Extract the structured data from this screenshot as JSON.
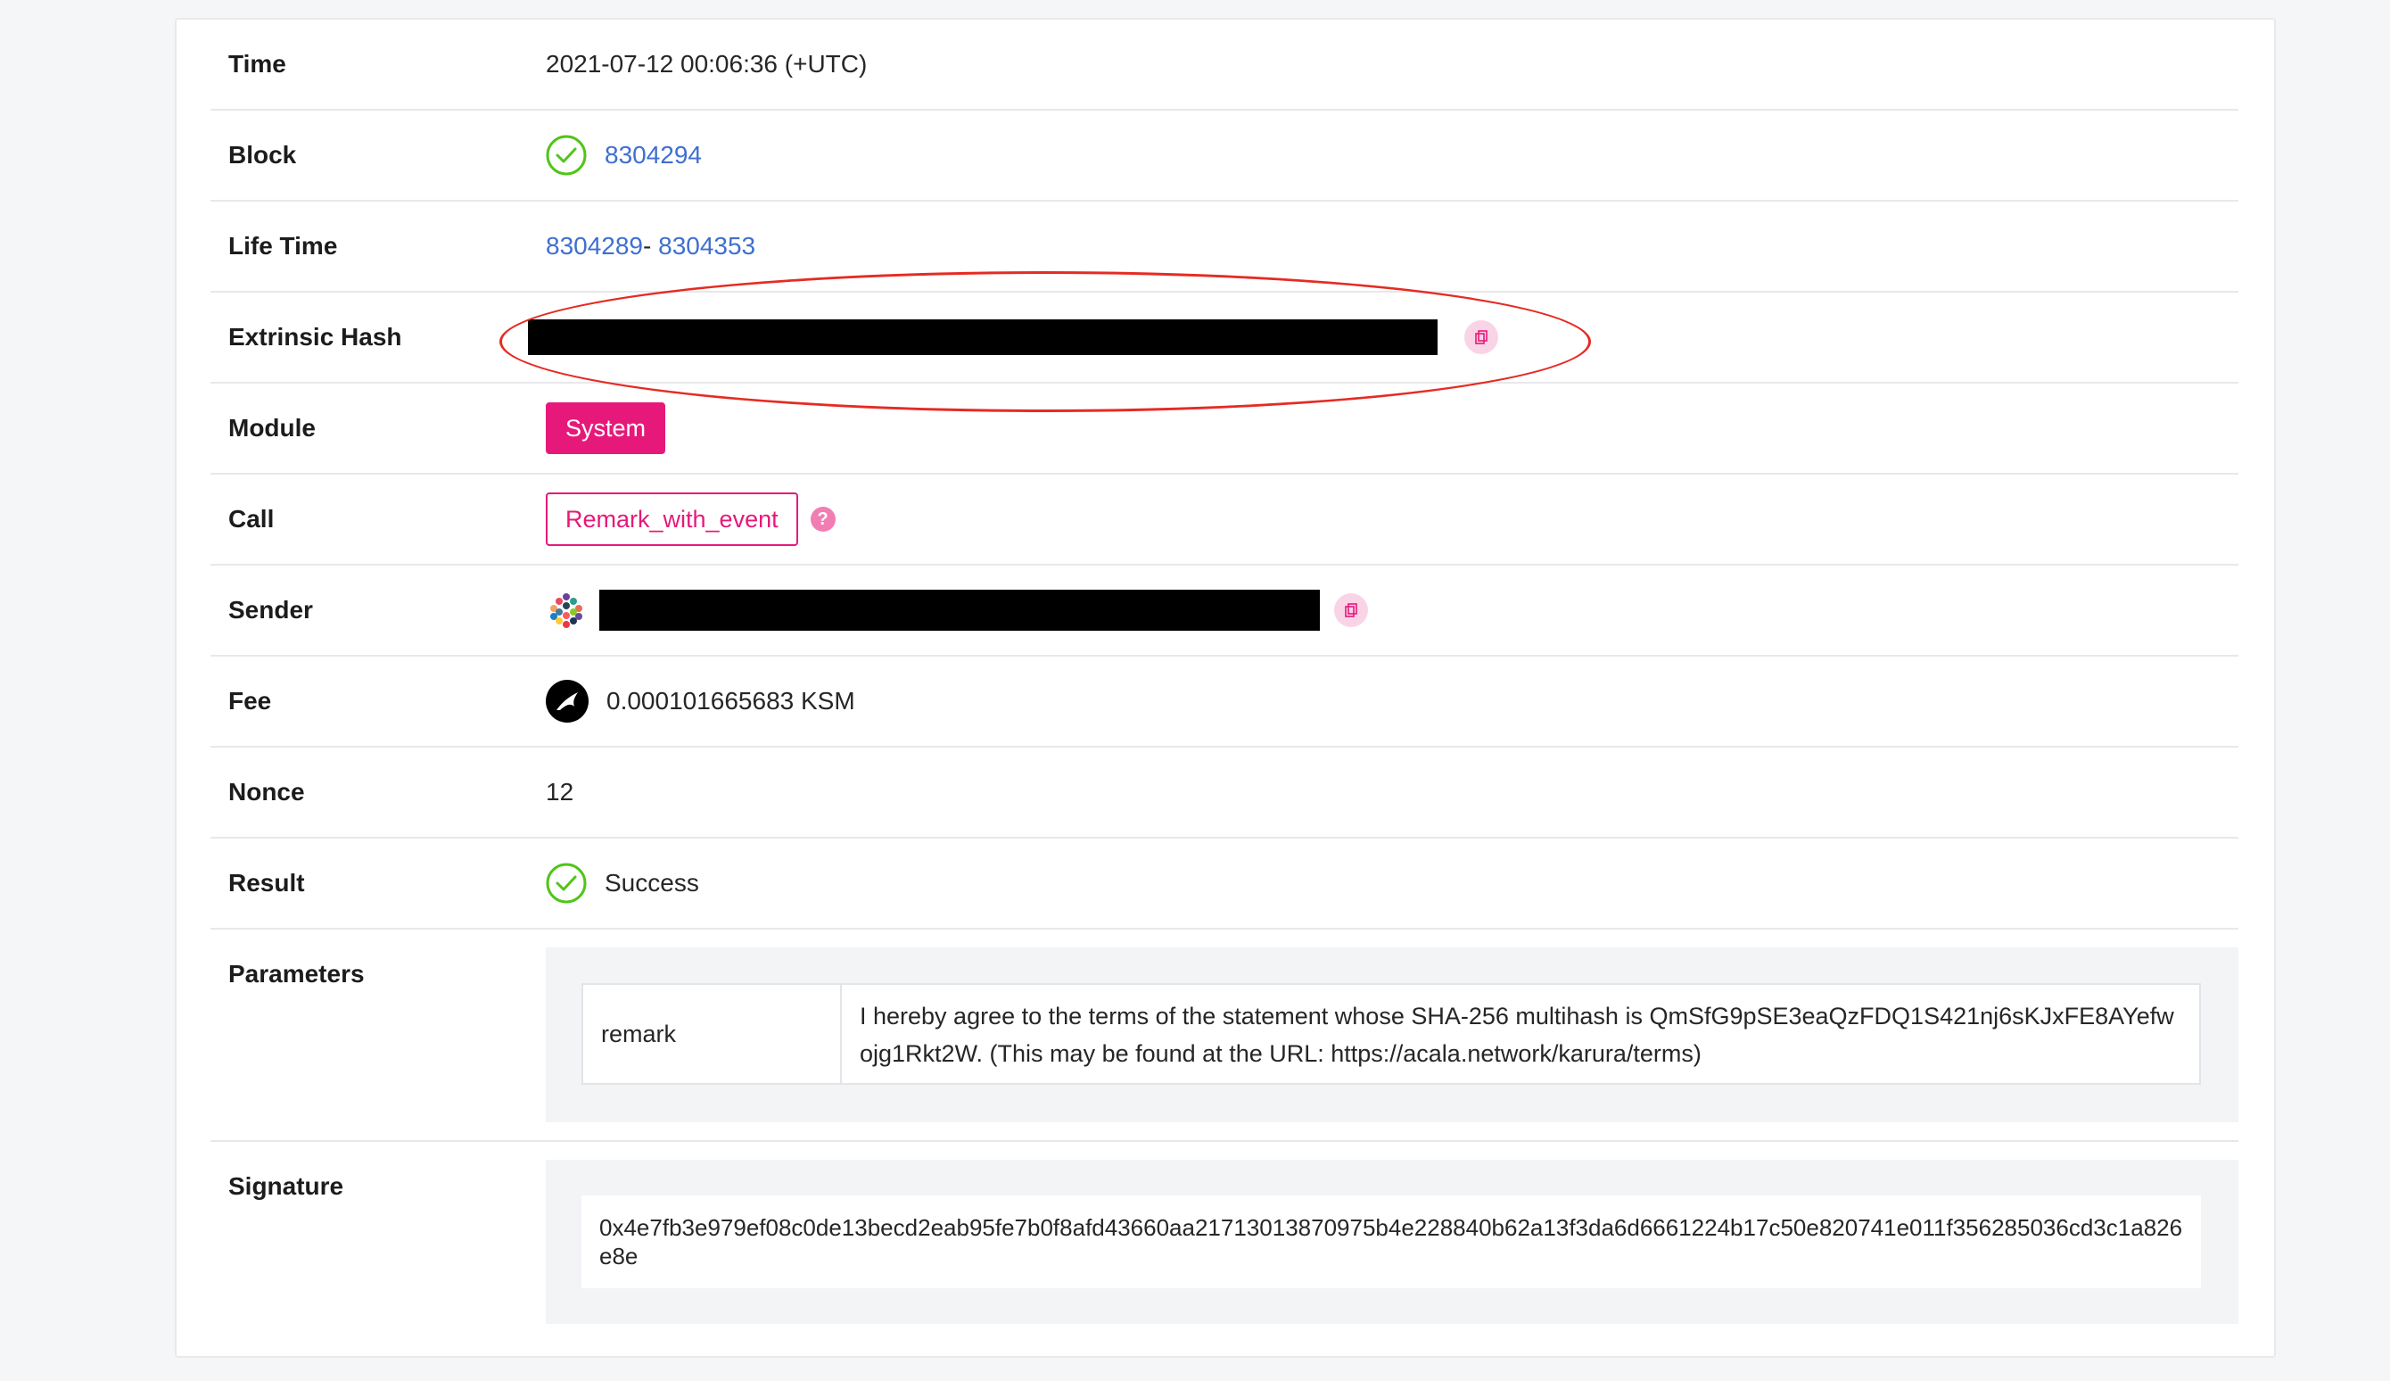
{
  "rows": {
    "time": {
      "label": "Time",
      "value": "2021-07-12 00:06:36 (+UTC)"
    },
    "block": {
      "label": "Block",
      "value": "8304294"
    },
    "lifetime": {
      "label": "Life Time",
      "start": "8304289",
      "separator": "- ",
      "end": "8304353"
    },
    "hash": {
      "label": "Extrinsic Hash"
    },
    "module": {
      "label": "Module",
      "value": "System"
    },
    "call": {
      "label": "Call",
      "value": "Remark_with_event",
      "help": "?"
    },
    "sender": {
      "label": "Sender"
    },
    "fee": {
      "label": "Fee",
      "value": "0.000101665683 KSM"
    },
    "nonce": {
      "label": "Nonce",
      "value": "12"
    },
    "result": {
      "label": "Result",
      "value": "Success"
    },
    "parameters": {
      "label": "Parameters",
      "key": "remark",
      "value": "I hereby agree to the terms of the statement whose SHA-256 multihash is QmSfG9pSE3eaQzFDQ1S421nj6sKJxFE8AYefwojg1Rkt2W. (This may be found at the URL: https://acala.network/karura/terms)"
    },
    "signature": {
      "label": "Signature",
      "value": "0x4e7fb3e979ef08c0de13becd2eab95fe7b0f8afd43660aa21713013870975b4e228840b62a13f3da6d6661224b17c50e820741e011f356285036cd3c1a826e8e"
    }
  },
  "colors": {
    "accent": "#e6197a",
    "link": "#3f6fd0",
    "success": "#52c41a",
    "annotation": "#e52b23"
  },
  "icons": [
    "check-circle-icon",
    "copy-icon",
    "help-icon",
    "identicon-avatar",
    "kusama-icon"
  ]
}
